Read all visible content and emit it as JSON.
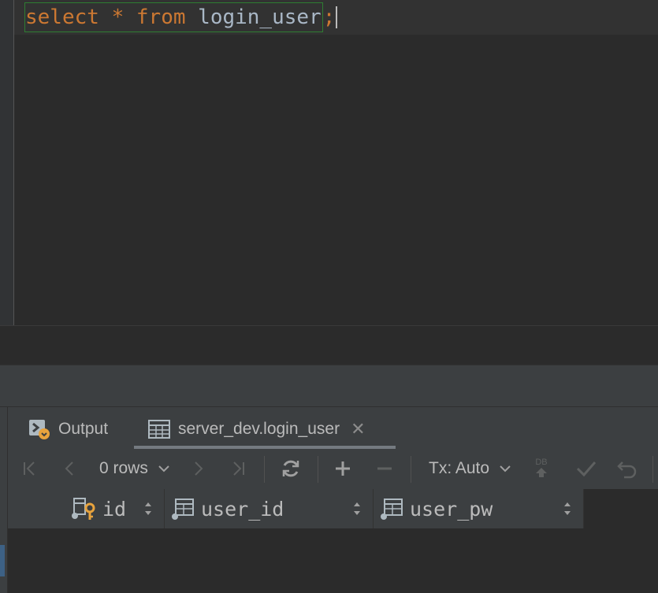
{
  "editor": {
    "sql_tokens": [
      {
        "text": "select",
        "kind": "keyword"
      },
      {
        "text": " * ",
        "kind": "operator"
      },
      {
        "text": "from",
        "kind": "keyword"
      },
      {
        "text": " login_user",
        "kind": "identifier"
      },
      {
        "text": ";",
        "kind": "punct"
      }
    ]
  },
  "panel": {
    "tabs": [
      {
        "label": "Output",
        "icon": "console-output-icon"
      },
      {
        "label": "server_dev.login_user",
        "icon": "table-grid-icon",
        "active": true
      }
    ],
    "toolbar": {
      "rows_label": "0 rows",
      "tx_label": "Tx: Auto",
      "db_badge": "DB"
    },
    "grid": {
      "columns": [
        {
          "label": "id",
          "icon": "primary-key-column-icon"
        },
        {
          "label": "user_id",
          "icon": "column-icon"
        },
        {
          "label": "user_pw",
          "icon": "column-icon"
        }
      ]
    }
  },
  "colors": {
    "keyword": "#cc7832",
    "identifier": "#a9b7c6",
    "editor_bg": "#2b2b2b",
    "panel_bg": "#3c3f41"
  }
}
